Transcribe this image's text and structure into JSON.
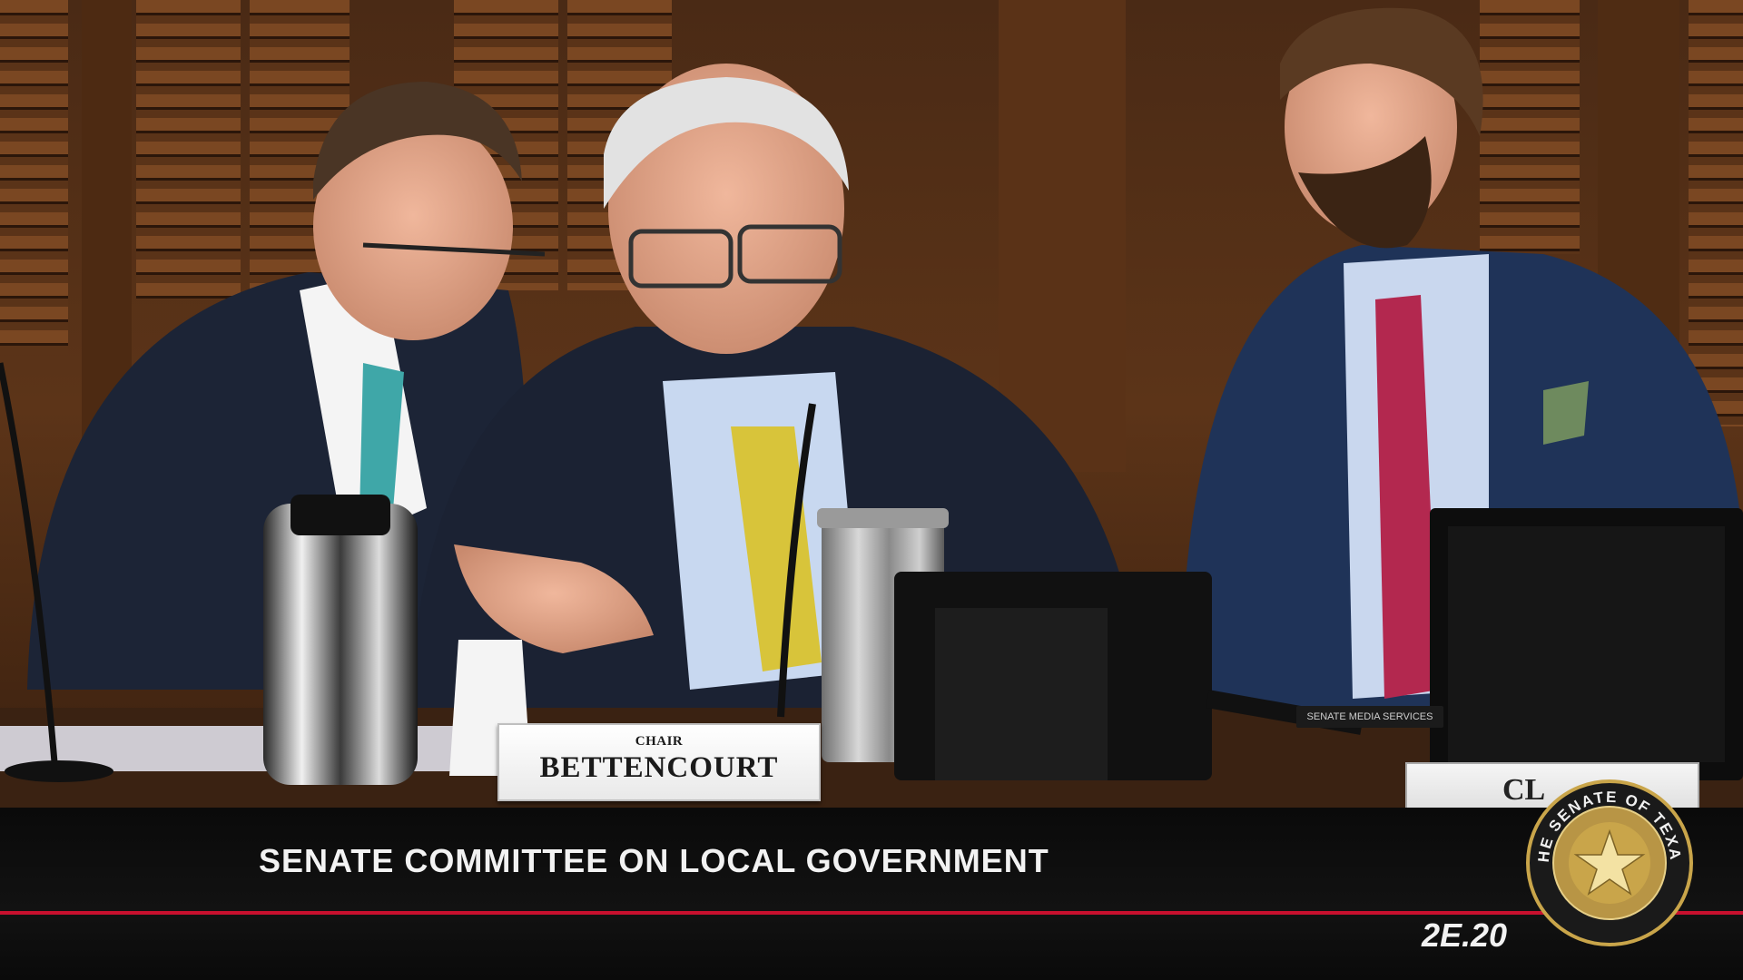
{
  "broadcast": {
    "committee_title": "SENATE COMMITTEE ON LOCAL GOVERNMENT",
    "room_code": "2E.20"
  },
  "nameplate": {
    "role": "CHAIR",
    "name": "BETTENCOURT"
  },
  "second_nameplate": {
    "partial_text": "CL"
  },
  "mic_base": {
    "label": "SENATE MEDIA SERVICES"
  },
  "seal": {
    "text": "THE SENATE OF TEXAS"
  },
  "colors": {
    "accent_rule": "#c8102e",
    "lower_third_bg": "#0e0e0e",
    "seal_gold": "#c9a54a"
  }
}
